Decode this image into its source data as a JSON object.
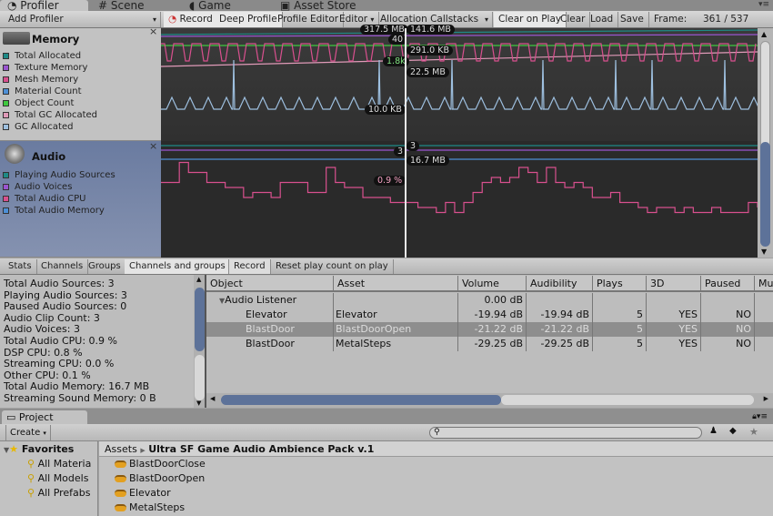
{
  "tabs": [
    {
      "label": "Profiler",
      "icon": "profiler-icon"
    },
    {
      "label": "Scene",
      "icon": "grid-icon"
    },
    {
      "label": "Game",
      "icon": "pacman-icon"
    },
    {
      "label": "Asset Store",
      "icon": "bag-icon"
    }
  ],
  "toolbar": {
    "add_profiler": "Add Profiler",
    "record": "Record",
    "deep_profile": "Deep Profile",
    "profile_editor": "Profile Editor",
    "editor": "Editor",
    "allocation_callstacks": "Allocation Callstacks",
    "clear_on_play": "Clear on Play",
    "clear": "Clear",
    "load": "Load",
    "save": "Save",
    "frame_label": "Frame:",
    "frame_value": "361 / 537"
  },
  "memory": {
    "title": "Memory",
    "legend": [
      {
        "label": "Total Allocated",
        "color": "#1e8a86"
      },
      {
        "label": "Texture Memory",
        "color": "#9a55d0"
      },
      {
        "label": "Mesh Memory",
        "color": "#d8508e"
      },
      {
        "label": "Material Count",
        "color": "#4d8fd6"
      },
      {
        "label": "Object Count",
        "color": "#3ec83e"
      },
      {
        "label": "Total GC Allocated",
        "color": "#e09ab8"
      },
      {
        "label": "GC Allocated",
        "color": "#9ec0e0"
      }
    ],
    "labels": [
      "317.5 MB",
      "141.6 MB",
      "40",
      "291.0 KB",
      "1.8k",
      "22.5 MB",
      "10.0 KB"
    ]
  },
  "audio": {
    "title": "Audio",
    "legend": [
      {
        "label": "Playing Audio Sources",
        "color": "#1e8a86"
      },
      {
        "label": "Audio Voices",
        "color": "#9a55d0"
      },
      {
        "label": "Total Audio CPU",
        "color": "#d8508e"
      },
      {
        "label": "Total Audio Memory",
        "color": "#4d8fd6"
      }
    ],
    "labels": [
      "3",
      "3",
      "16.7 MB",
      "0.9 %"
    ],
    "cpu_series": [
      0.9,
      0.9,
      1.3,
      1.1,
      1.1,
      0.9,
      0.9,
      0.8,
      0.8,
      0.6,
      0.7,
      0.7,
      0.6,
      0.9,
      0.9,
      0.9,
      0.7,
      0.7,
      1.2,
      0.9,
      0.8,
      0.8,
      0.6,
      0.6,
      0.6,
      0.5,
      0.5,
      0.5,
      0.4,
      0.4,
      0.3,
      0.5,
      0.3,
      0.5,
      0.7,
      0.9,
      1.0,
      0.9,
      1.0,
      1.2,
      1.1,
      0.9,
      1.2,
      0.9,
      0.8,
      0.9,
      0.8,
      0.6,
      0.6,
      0.7,
      0.5,
      0.5,
      0.4,
      0.3,
      0.4,
      0.4,
      0.3,
      0.4,
      0.3,
      0.3,
      0.4,
      0.3,
      0.3,
      0.3,
      0.5,
      0.4
    ]
  },
  "audio_toolbar": {
    "stats": "Stats",
    "channels": "Channels",
    "groups": "Groups",
    "channels_and_groups": "Channels and groups",
    "record": "Record",
    "reset_play_count": "Reset play count on play"
  },
  "stats": [
    "Total Audio Sources: 3",
    "Playing Audio Sources: 3",
    "Paused Audio Sources: 0",
    "Audio Clip Count: 3",
    "Audio Voices: 3",
    "Total Audio CPU: 0.9 %",
    "DSP CPU: 0.8 %",
    "Streaming CPU: 0.0 %",
    "Other CPU: 0.1 %",
    "Total Audio Memory: 16.7 MB",
    "Streaming Sound Memory: 0 B"
  ],
  "table": {
    "columns": [
      "Object",
      "Asset",
      "Volume",
      "Audibility",
      "Plays",
      "3D",
      "Paused",
      "Mu"
    ],
    "rows": [
      {
        "object": "Audio Listener",
        "asset": "",
        "volume": "0.00 dB",
        "audibility": "",
        "plays": "",
        "3d": "",
        "paused": ""
      },
      {
        "object": "Elevator",
        "asset": "Elevator",
        "volume": "-19.94 dB",
        "audibility": "-19.94 dB",
        "plays": "5",
        "3d": "YES",
        "paused": "NO"
      },
      {
        "object": "BlastDoor",
        "asset": "BlastDoorOpen",
        "volume": "-21.22 dB",
        "audibility": "-21.22 dB",
        "plays": "5",
        "3d": "YES",
        "paused": "NO",
        "selected": true
      },
      {
        "object": "BlastDoor",
        "asset": "MetalSteps",
        "volume": "-29.25 dB",
        "audibility": "-29.25 dB",
        "plays": "5",
        "3d": "YES",
        "paused": "NO"
      }
    ]
  },
  "project": {
    "tab": "Project",
    "create": "Create",
    "search_placeholder": "",
    "favorites": "Favorites",
    "fav_items": [
      "All Materia",
      "All Models",
      "All Prefabs"
    ],
    "breadcrumb_root": "Assets",
    "breadcrumb_current": "Ultra SF Game Audio Ambience Pack v.1",
    "assets": [
      "BlastDoorClose",
      "BlastDoorOpen",
      "Elevator",
      "MetalSteps"
    ]
  }
}
